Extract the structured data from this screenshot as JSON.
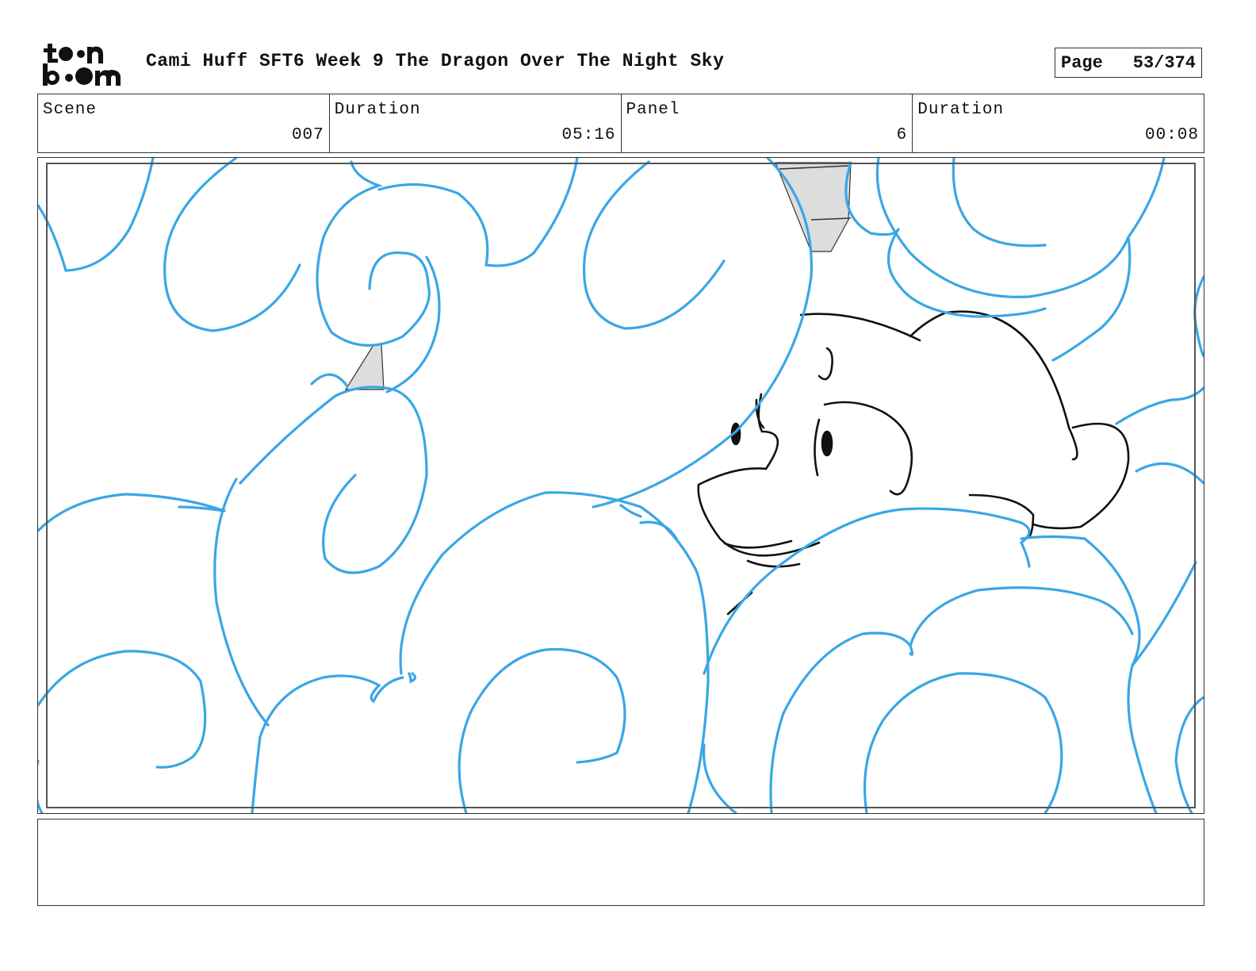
{
  "header": {
    "logo_text": "toon boom",
    "title": "Cami Huff SFT6 Week 9 The Dragon Over The Night Sky",
    "page_label": "Page",
    "page_value": "53/374"
  },
  "info": {
    "scene_label": "Scene",
    "scene_value": "007",
    "scene_duration_label": "Duration",
    "scene_duration_value": "05:16",
    "panel_label": "Panel",
    "panel_value": "6",
    "panel_duration_label": "Duration",
    "panel_duration_value": "00:08"
  },
  "panel": {
    "cloud_color": "#3aa6e6",
    "line_color": "#111111",
    "shade_color": "#dddddd"
  },
  "notes": {
    "text": ""
  }
}
